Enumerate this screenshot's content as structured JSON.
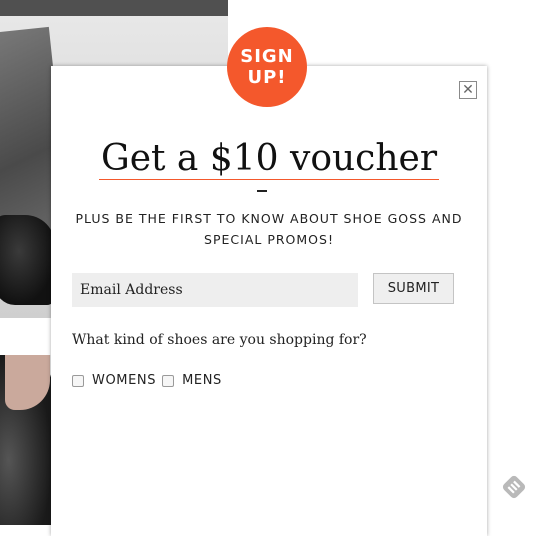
{
  "badge": {
    "line1": "SIGN",
    "line2": "UP!"
  },
  "modal": {
    "close_glyph": "✕",
    "headline": "Get a $10 voucher",
    "subhead": "PLUS BE THE FIRST TO KNOW ABOUT SHOE GOSS AND SPECIAL PROMOS!",
    "email": {
      "placeholder": "Email Address",
      "value": ""
    },
    "submit_label": "SUBMIT",
    "question": "What kind of shoes are you shopping for?",
    "options": [
      {
        "label": "WOMENS",
        "checked": false
      },
      {
        "label": "MENS",
        "checked": false
      }
    ]
  },
  "icons": {
    "close": "close-icon",
    "corner": "feedly-icon"
  },
  "colors": {
    "accent": "#f4582c",
    "input_bg": "#eeeeee",
    "button_bg": "#efefef"
  }
}
